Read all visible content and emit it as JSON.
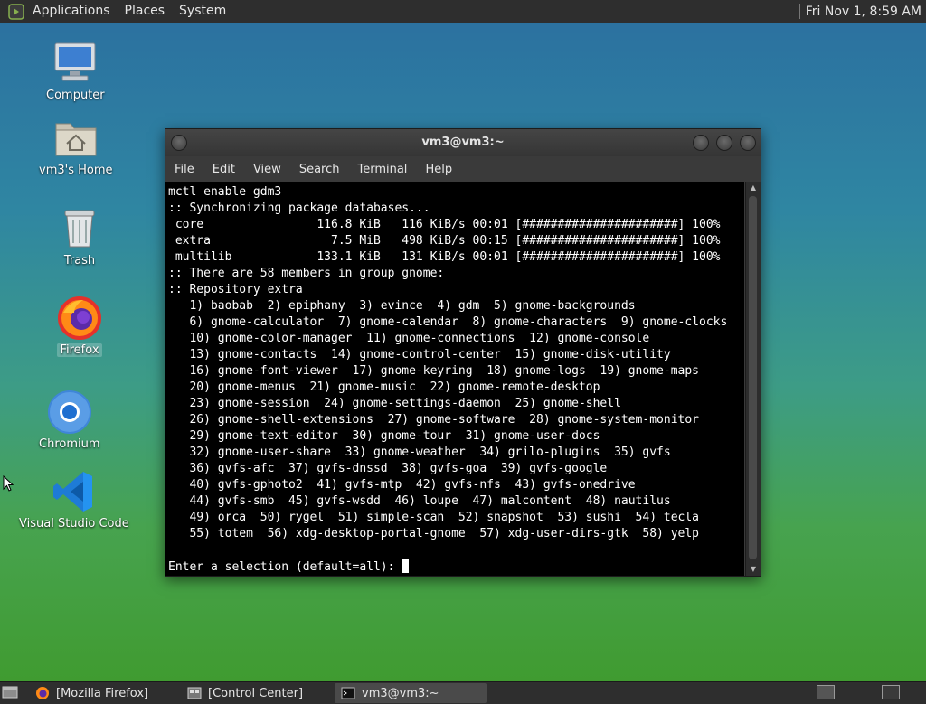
{
  "top_panel": {
    "menus": [
      "Applications",
      "Places",
      "System"
    ],
    "clock": "Fri Nov 1, 8:59 AM"
  },
  "desktop_icons": [
    {
      "label": "Computer",
      "icon": "computer-icon"
    },
    {
      "label": "vm3's Home",
      "icon": "home-folder-icon"
    },
    {
      "label": "Trash",
      "icon": "trash-icon"
    },
    {
      "label": "Firefox",
      "icon": "firefox-icon"
    },
    {
      "label": "Chromium",
      "icon": "chromium-icon"
    },
    {
      "label": "Visual Studio Code",
      "icon": "vscode-icon"
    }
  ],
  "terminal": {
    "title": "vm3@vm3:~",
    "menus": [
      "File",
      "Edit",
      "View",
      "Search",
      "Terminal",
      "Help"
    ],
    "lines": [
      "mctl enable gdm3",
      ":: Synchronizing package databases...",
      " core                116.8 KiB   116 KiB/s 00:01 [######################] 100%",
      " extra                 7.5 MiB   498 KiB/s 00:15 [######################] 100%",
      " multilib            133.1 KiB   131 KiB/s 00:01 [######################] 100%",
      ":: There are 58 members in group gnome:",
      ":: Repository extra",
      "   1) baobab  2) epiphany  3) evince  4) gdm  5) gnome-backgrounds",
      "   6) gnome-calculator  7) gnome-calendar  8) gnome-characters  9) gnome-clocks",
      "   10) gnome-color-manager  11) gnome-connections  12) gnome-console",
      "   13) gnome-contacts  14) gnome-control-center  15) gnome-disk-utility",
      "   16) gnome-font-viewer  17) gnome-keyring  18) gnome-logs  19) gnome-maps",
      "   20) gnome-menus  21) gnome-music  22) gnome-remote-desktop",
      "   23) gnome-session  24) gnome-settings-daemon  25) gnome-shell",
      "   26) gnome-shell-extensions  27) gnome-software  28) gnome-system-monitor",
      "   29) gnome-text-editor  30) gnome-tour  31) gnome-user-docs",
      "   32) gnome-user-share  33) gnome-weather  34) grilo-plugins  35) gvfs",
      "   36) gvfs-afc  37) gvfs-dnssd  38) gvfs-goa  39) gvfs-google",
      "   40) gvfs-gphoto2  41) gvfs-mtp  42) gvfs-nfs  43) gvfs-onedrive",
      "   44) gvfs-smb  45) gvfs-wsdd  46) loupe  47) malcontent  48) nautilus",
      "   49) orca  50) rygel  51) simple-scan  52) snapshot  53) sushi  54) tecla",
      "   55) totem  56) xdg-desktop-portal-gnome  57) xdg-user-dirs-gtk  58) yelp",
      ""
    ],
    "prompt": "Enter a selection (default=all): "
  },
  "taskbar": {
    "tasks": [
      {
        "label": "[Mozilla Firefox]",
        "icon": "firefox-icon"
      },
      {
        "label": "[Control Center]",
        "icon": "control-center-icon"
      },
      {
        "label": "vm3@vm3:~",
        "icon": "terminal-icon"
      }
    ]
  }
}
